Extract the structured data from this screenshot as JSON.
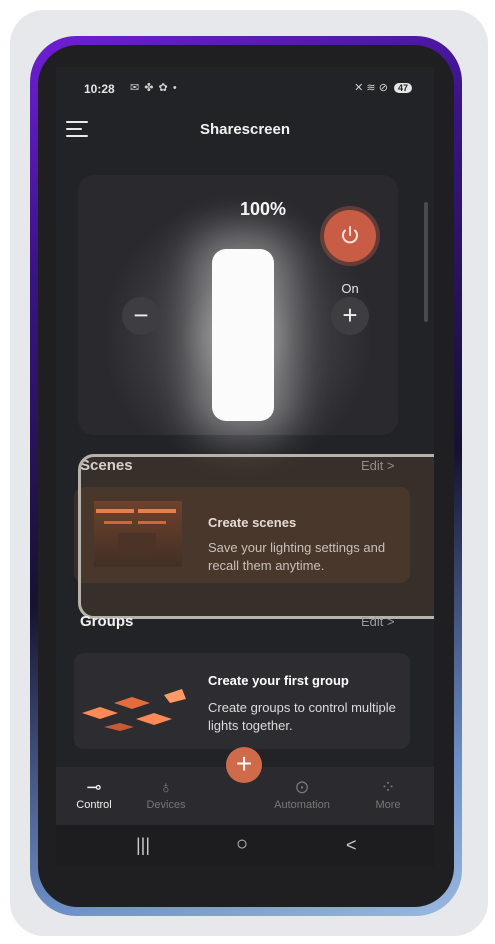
{
  "status_bar": {
    "time": "10:28",
    "left_icons": "✉ ✤ ✿ •",
    "right_icons": "✕ ≋ ⊘",
    "battery": "47"
  },
  "header": {
    "title": "Sharescreen",
    "menu_icon": "hamburger-menu-icon"
  },
  "light": {
    "brightness": "100%",
    "power_state": "On",
    "decrease_label": "−",
    "increase_label": "+"
  },
  "scenes": {
    "title": "Scenes",
    "edit_label": "Edit  >",
    "card_title": "Create scenes",
    "card_desc": "Save your lighting settings and recall them anytime."
  },
  "groups": {
    "title": "Groups",
    "edit_label": "Edit  >",
    "card_title": "Create your first group",
    "card_desc": "Create groups to control multiple lights together."
  },
  "bottom_nav": {
    "items": [
      {
        "label": "Control",
        "icon": "control-sliders-icon"
      },
      {
        "label": "Devices",
        "icon": "devices-bulb-icon"
      },
      {
        "label": "Automation",
        "icon": "automation-icon"
      },
      {
        "label": "More",
        "icon": "more-grid-icon"
      }
    ],
    "fab_label": "+"
  },
  "system_nav": {
    "recents": "|||",
    "home": "○",
    "back": "<"
  },
  "colors": {
    "accent": "#cf6a4b",
    "background": "#222326",
    "highlight_border": "#b6b3ad"
  }
}
